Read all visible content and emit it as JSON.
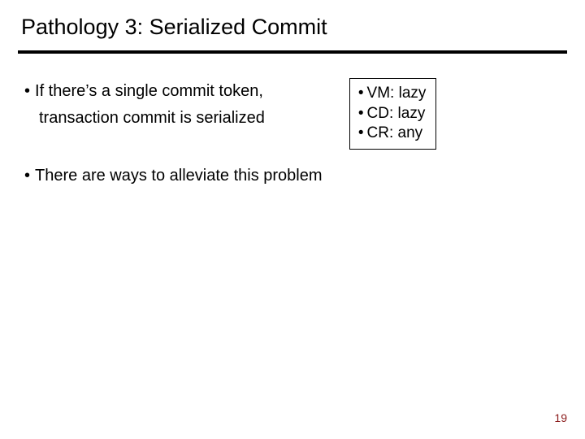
{
  "title": "Pathology 3: Serialized Commit",
  "bullets": {
    "b1_line1": "If there’s a single commit token,",
    "b1_line2": "transaction commit is serialized",
    "b2": "There are ways to alleviate this problem"
  },
  "box": {
    "vm_label": "VM:",
    "vm_value": "lazy",
    "cd_label": "CD:",
    "cd_value": "lazy",
    "cr_label": "CR:",
    "cr_value": "any"
  },
  "marks": {
    "bullet": "•"
  },
  "page_number": "19"
}
